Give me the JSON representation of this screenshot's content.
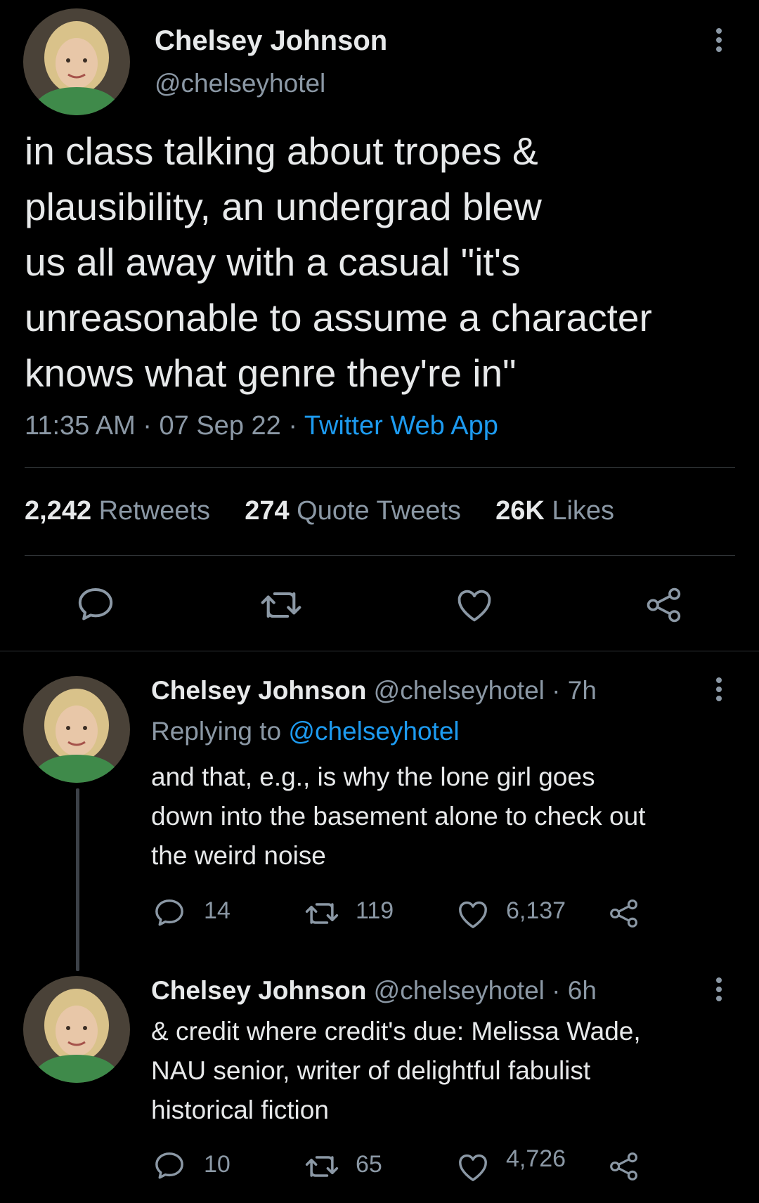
{
  "main_tweet": {
    "author_name": "Chelsey Johnson",
    "handle": "@chelseyhotel",
    "text_lines": [
      "in class talking about tropes &",
      "plausibility, an undergrad blew",
      "us all away with a casual \"it's",
      "unreasonable to assume a character",
      "knows what genre they're in\""
    ],
    "time": "11:35 AM",
    "date": "07 Sep 22",
    "source": "Twitter Web App",
    "stats": {
      "retweets_count": "2,242",
      "retweets_label": "Retweets",
      "quotes_count": "274",
      "quotes_label": "Quote Tweets",
      "likes_count": "26K",
      "likes_label": "Likes"
    }
  },
  "replies": [
    {
      "author_name": "Chelsey Johnson",
      "handle": "@chelseyhotel",
      "age": "7h",
      "replying_to_prefix": "Replying to",
      "replying_to_handle": "@chelseyhotel",
      "text_lines": [
        "and that, e.g., is why the lone girl goes",
        "down into the basement alone to check out",
        "the weird noise"
      ],
      "reply_count": "14",
      "retweet_count": "119",
      "like_count": "6,137"
    },
    {
      "author_name": "Chelsey Johnson",
      "handle": "@chelseyhotel",
      "age": "6h",
      "text_lines": [
        "& credit where credit's due: Melissa Wade,",
        "NAU senior, writer of delightful fabulist",
        "historical fiction"
      ],
      "reply_count": "10",
      "retweet_count": "65",
      "like_count": "4,726"
    }
  ],
  "colors": {
    "background": "#000000",
    "text": "#e7e9ea",
    "muted": "#8b98a5",
    "link": "#1d9bf0",
    "divider": "#2f3336"
  }
}
